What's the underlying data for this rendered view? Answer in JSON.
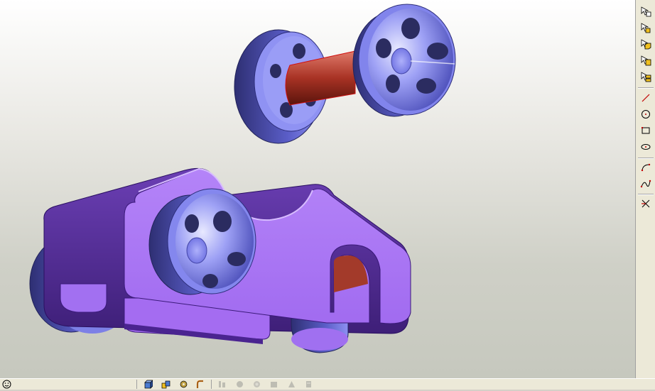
{
  "app": {
    "accent": "#b07ef7",
    "axle_color": "#b03a2e",
    "wheel_color": "#8b8ef0"
  },
  "viewport": {
    "models": [
      "wheel-axle-assembly",
      "car-body-assembly"
    ]
  },
  "right_toolbar": {
    "groups": [
      [
        "select-edge-icon",
        "select-face-icon",
        "select-body-icon",
        "select-component-icon",
        "select-all-icon"
      ],
      [
        "line-icon",
        "circle-icon",
        "rectangle-icon",
        "ellipse-icon"
      ],
      [
        "arc-icon",
        "spline-icon"
      ],
      [
        "trim-icon"
      ]
    ]
  },
  "status_bar": {
    "left_icon": "smiley-icon",
    "icons_active": [
      "part-icon",
      "assembly-icon",
      "gear-icon",
      "bend-icon"
    ],
    "icons_disabled": [
      "disabled-tool-1",
      "disabled-tool-2",
      "disabled-tool-3",
      "disabled-tool-4",
      "disabled-tool-5",
      "disabled-tool-6"
    ]
  }
}
